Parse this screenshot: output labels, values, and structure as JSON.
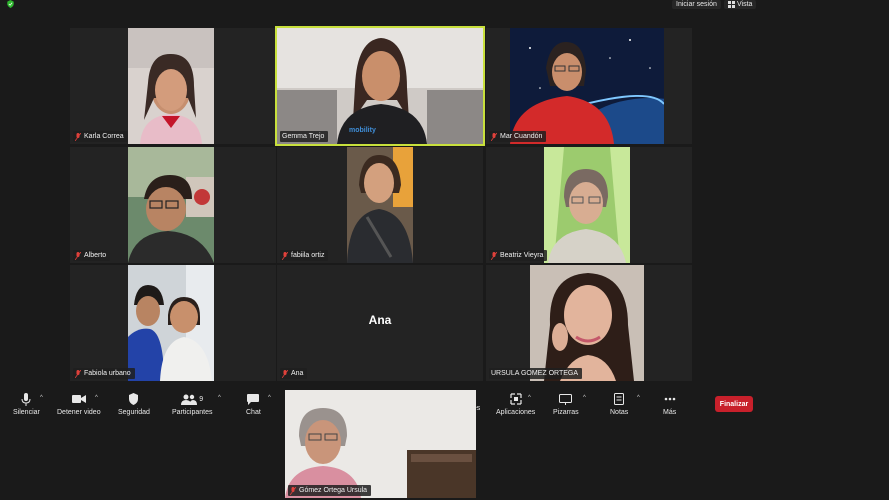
{
  "top_bar": {
    "signin_label": "Iniciar sesión",
    "view_label": "Vista"
  },
  "participants": [
    {
      "name": "Karla Correa",
      "muted": true
    },
    {
      "name": "Gemma Trejo",
      "muted": false,
      "active_speaker": true
    },
    {
      "name": "Mar Cuandón",
      "muted": true
    },
    {
      "name": "Alberto",
      "muted": true
    },
    {
      "name": "fabiila ortiz",
      "muted": true
    },
    {
      "name": "Beatriz Vieyra",
      "muted": true
    },
    {
      "name": "Fabiola urbano",
      "muted": true
    },
    {
      "name": "Ana",
      "muted": true,
      "video_off": true
    },
    {
      "name": "URSULA GOMEZ ORTEGA",
      "muted": false
    },
    {
      "name": "Gómez Ortega Ursula",
      "muted": true,
      "self_view": true
    }
  ],
  "toolbar": {
    "mute_label": "Silenciar",
    "stop_video_label": "Detener video",
    "security_label": "Seguridad",
    "participants_label": "Participantes",
    "participants_count": "9",
    "chat_label": "Chat",
    "share_label_partial": "nes",
    "apps_label": "Aplicaciones",
    "whiteboards_label": "Pizarras",
    "notes_label": "Notas",
    "more_label": "Más",
    "end_label": "Finalizar"
  },
  "colors": {
    "active_speaker_border": "#c8e03c",
    "muted_mic": "#e0413b",
    "end_button": "#c8202b",
    "background": "#1a1a1a"
  }
}
